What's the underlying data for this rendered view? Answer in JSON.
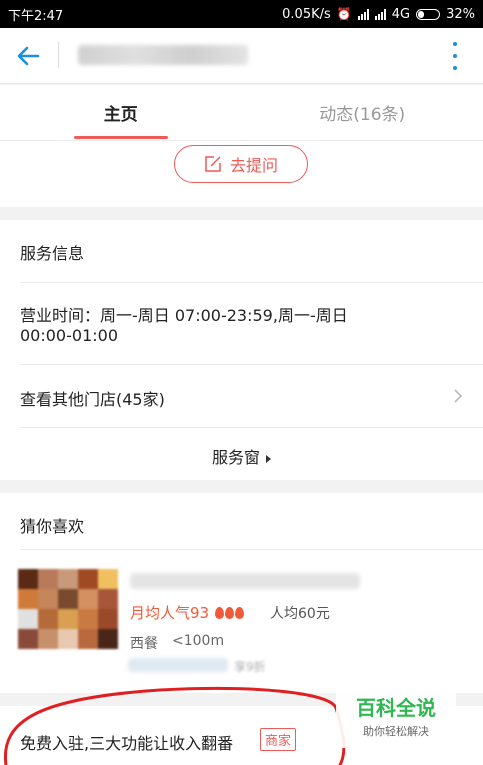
{
  "status_bar": {
    "time": "下午2:47",
    "net_speed": "0.05K/s",
    "network": "4G",
    "battery": "32%",
    "battery_level": 0.32
  },
  "tabs": [
    {
      "label": "主页",
      "active": true
    },
    {
      "label": "动态(16条)",
      "active": false
    }
  ],
  "ask_button": {
    "label": "去提问"
  },
  "service": {
    "heading": "服务信息",
    "hours_line1": "营业时间：周一-周日 07:00-23:59,周一-周日",
    "hours_line2": "00:00-01:00",
    "other_stores": "查看其他门店(45家)",
    "service_window": "服务窗"
  },
  "guess": {
    "heading": "猜你喜欢",
    "items": [
      {
        "popularity": "月均人气93",
        "avg_price": "人均60元",
        "category": "西餐",
        "distance": "<100m",
        "promo": "享9折"
      }
    ]
  },
  "banner": {
    "text": "免费入驻,三大功能让收入翻番",
    "tag": "商家"
  },
  "watermark": {
    "title": "百科全说",
    "subtitle": "助你轻松解决"
  },
  "colors": {
    "accent_blue": "#1a8fe3",
    "accent_red": "#f05a55",
    "watermark_green": "#2fb84f"
  }
}
